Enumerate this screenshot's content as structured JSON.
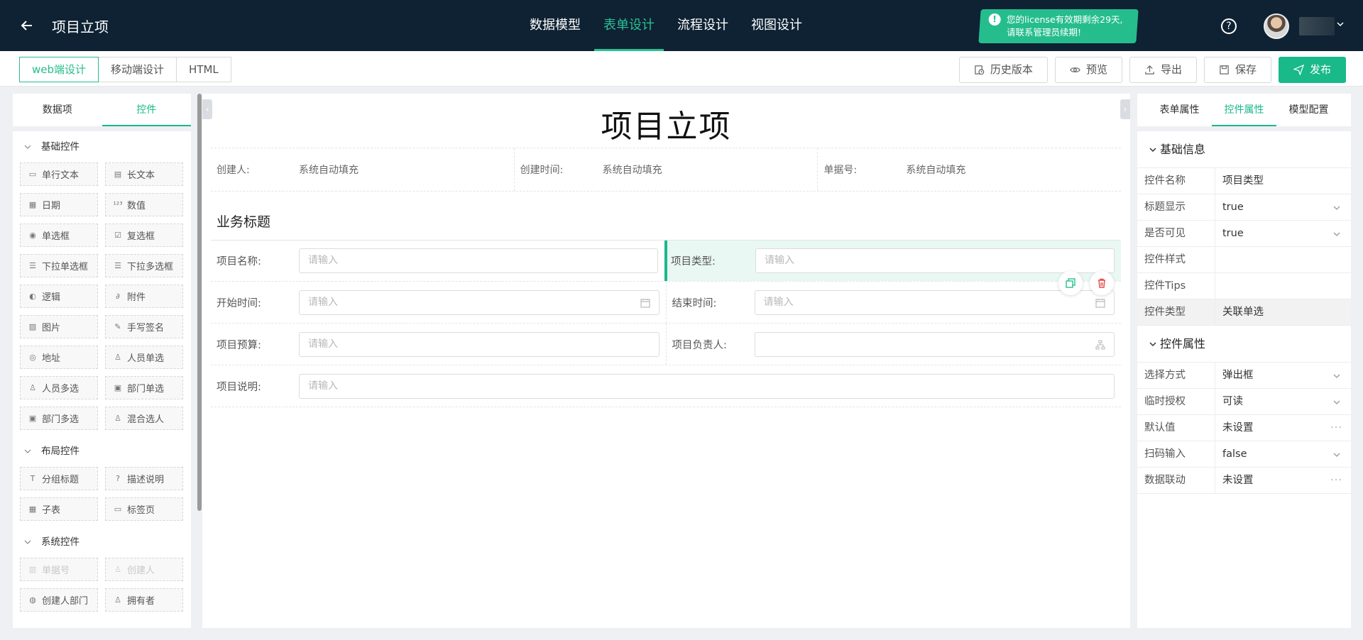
{
  "header": {
    "title": "项目立项",
    "nav": [
      {
        "label": "数据模型",
        "active": false
      },
      {
        "label": "表单设计",
        "active": true
      },
      {
        "label": "流程设计",
        "active": false
      },
      {
        "label": "视图设计",
        "active": false
      }
    ],
    "license_line1": "您的license有效期剩余29天,",
    "license_line2": "请联系管理员续期!",
    "accent_color": "#19b98a",
    "bg_color": "#0e2233"
  },
  "modes": [
    "web端设计",
    "移动端设计",
    "HTML"
  ],
  "actions": {
    "history": "历史版本",
    "preview": "预览",
    "export": "导出",
    "save": "保存",
    "publish": "发布"
  },
  "left": {
    "tabs": [
      "数据项",
      "控件"
    ],
    "basic_title": "基础控件",
    "basic": [
      {
        "label": "单行文本",
        "icon": "textbox-icon"
      },
      {
        "label": "长文本",
        "icon": "textarea-icon"
      },
      {
        "label": "日期",
        "icon": "calendar-icon"
      },
      {
        "label": "数值",
        "icon": "number-icon"
      },
      {
        "label": "单选框",
        "icon": "radio-icon"
      },
      {
        "label": "复选框",
        "icon": "checkbox-icon"
      },
      {
        "label": "下拉单选框",
        "icon": "dropdown-icon"
      },
      {
        "label": "下拉多选框",
        "icon": "dropdown-multi-icon"
      },
      {
        "label": "逻辑",
        "icon": "toggle-icon"
      },
      {
        "label": "附件",
        "icon": "paperclip-icon"
      },
      {
        "label": "图片",
        "icon": "image-icon"
      },
      {
        "label": "手写签名",
        "icon": "pen-icon"
      },
      {
        "label": "地址",
        "icon": "location-icon"
      },
      {
        "label": "人员单选",
        "icon": "user-icon"
      },
      {
        "label": "人员多选",
        "icon": "users-icon"
      },
      {
        "label": "部门单选",
        "icon": "department-icon"
      },
      {
        "label": "部门多选",
        "icon": "departments-icon"
      },
      {
        "label": "混合选人",
        "icon": "user-mixed-icon"
      }
    ],
    "layout_title": "布局控件",
    "layout": [
      {
        "label": "分组标题",
        "icon": "heading-icon"
      },
      {
        "label": "描述说明",
        "icon": "help-circle-icon"
      },
      {
        "label": "子表",
        "icon": "table-icon"
      },
      {
        "label": "标签页",
        "icon": "tabs-icon"
      }
    ],
    "system_title": "系统控件",
    "system": [
      {
        "label": "单据号",
        "icon": "barcode-icon",
        "disabled": true
      },
      {
        "label": "创建人",
        "icon": "user-icon",
        "disabled": true
      },
      {
        "label": "创建人部门",
        "icon": "org-icon",
        "disabled": false
      },
      {
        "label": "拥有者",
        "icon": "owner-icon",
        "disabled": false
      }
    ]
  },
  "form": {
    "title": "项目立项",
    "meta": [
      {
        "label": "创建人:",
        "value": "系统自动填充"
      },
      {
        "label": "创建时间:",
        "value": "系统自动填充"
      },
      {
        "label": "单据号:",
        "value": "系统自动填充"
      }
    ],
    "section": "业务标题",
    "fields": {
      "name": {
        "label": "项目名称:",
        "placeholder": "请输入"
      },
      "type": {
        "label": "项目类型:",
        "placeholder": "请输入"
      },
      "start": {
        "label": "开始时间:",
        "placeholder": "请输入"
      },
      "end": {
        "label": "结束时间:",
        "placeholder": "请输入"
      },
      "budget": {
        "label": "项目预算:",
        "placeholder": "请输入"
      },
      "owner": {
        "label": "项目负责人:",
        "placeholder": ""
      },
      "desc": {
        "label": "项目说明:",
        "placeholder": "请输入"
      }
    }
  },
  "right": {
    "tabs": [
      "表单属性",
      "控件属性",
      "模型配置"
    ],
    "basic_title": "基础信息",
    "basic": [
      {
        "key": "控件名称",
        "value": "项目类型",
        "control": "text"
      },
      {
        "key": "标题显示",
        "value": "true",
        "control": "select"
      },
      {
        "key": "是否可见",
        "value": "true",
        "control": "select"
      },
      {
        "key": "控件样式",
        "value": "",
        "control": "text"
      },
      {
        "key": "控件Tips",
        "value": "",
        "control": "text"
      },
      {
        "key": "控件类型",
        "value": "关联单选",
        "control": "readonly"
      }
    ],
    "attr_title": "控件属性",
    "attrs": [
      {
        "key": "选择方式",
        "value": "弹出框",
        "control": "select"
      },
      {
        "key": "临时授权",
        "value": "可读",
        "control": "select"
      },
      {
        "key": "默认值",
        "value": "未设置",
        "control": "more"
      },
      {
        "key": "扫码输入",
        "value": "false",
        "control": "select"
      },
      {
        "key": "数据联动",
        "value": "未设置",
        "control": "more"
      }
    ]
  }
}
